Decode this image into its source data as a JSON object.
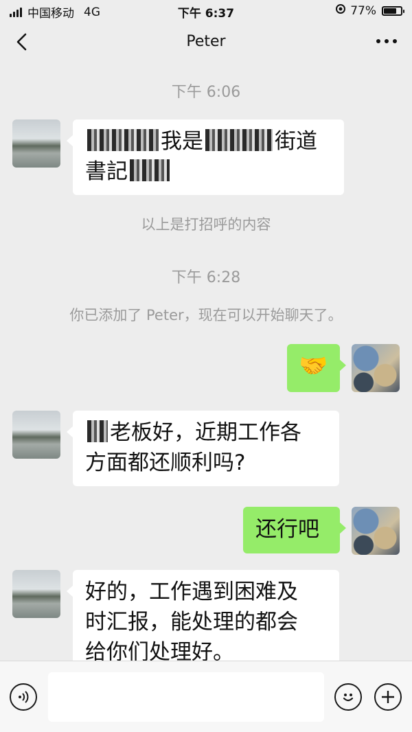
{
  "status_bar": {
    "carrier": "中国移动",
    "network": "4G",
    "time": "下午 6:37",
    "battery_percent": "77%",
    "battery_level": 0.77
  },
  "nav": {
    "title": "Peter"
  },
  "chat": {
    "timestamp_1": "下午 6:06",
    "msg_1_parts": [
      "我是",
      "街道",
      "書記"
    ],
    "system_1": "以上是打招呼的内容",
    "timestamp_2": "下午 6:28",
    "system_2": "你已添加了 Peter，现在可以开始聊天了。",
    "msg_2_emoji": "🤝",
    "msg_3_parts": [
      "老板好，近期工作各",
      "方面都还顺利吗?"
    ],
    "msg_4": "还行吧",
    "msg_5_lines": [
      "好的，工作遇到困难及",
      "时汇报，能处理的都会",
      "给你们处理好。"
    ]
  },
  "input_bar": {
    "input_value": ""
  },
  "colors": {
    "background": "#ededed",
    "bubble_incoming": "#ffffff",
    "bubble_outgoing": "#95ec69",
    "meta_text": "#9a9a9a"
  },
  "icons": [
    "signal-icon",
    "location-lock-icon",
    "battery-icon",
    "back-chevron-icon",
    "more-dots-icon",
    "voice-icon",
    "emoji-icon",
    "plus-icon"
  ]
}
